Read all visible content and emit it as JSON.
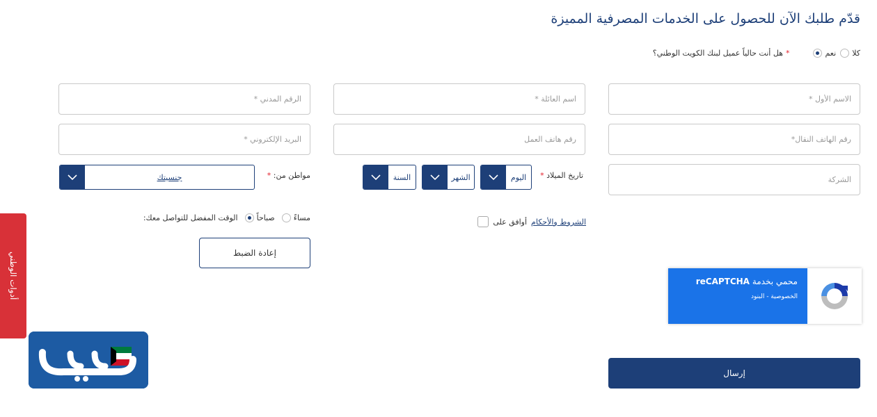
{
  "title": "قدّم طلبك الآن للحصول على الخدمات المصرفية المميزة",
  "customer_question": {
    "label": "هل أنت حالياً عميل لبنك الكويت الوطني؟",
    "required_mark": "*",
    "options": [
      {
        "label": "نعم",
        "selected": true
      },
      {
        "label": "كلا",
        "selected": false
      }
    ]
  },
  "fields": {
    "first_name": {
      "placeholder": "الاسم الأول *"
    },
    "family_name": {
      "placeholder": "اسم العائلة *"
    },
    "civil_id": {
      "placeholder": "الرقم المدني *"
    },
    "mobile": {
      "placeholder": "رقم الهاتف النقال*"
    },
    "work_phone": {
      "placeholder": "رقم هاتف العمل"
    },
    "email": {
      "placeholder": "البريد الإلكتروني *"
    },
    "company": {
      "placeholder": "الشركة"
    }
  },
  "birth_date": {
    "label": "تاريخ الميلاد",
    "required_mark": "*",
    "day": "اليوم",
    "month": "الشهر",
    "year": "السنة"
  },
  "citizenship": {
    "label": "مواطن من:",
    "required_mark": "*",
    "value": "جنسيتك"
  },
  "terms": {
    "prefix": "أوافق على",
    "link": "الشروط والأحكام"
  },
  "contact_time": {
    "label": "الوقت المفضل للتواصل معك:",
    "options": [
      {
        "label": "صباحاً",
        "selected": true
      },
      {
        "label": "مساءً",
        "selected": false
      }
    ]
  },
  "reset_label": "إعادة الضبط",
  "submit_label": "إرسال",
  "captcha": {
    "protected_by": "محمي بخدمة",
    "brand": "reCAPTCHA",
    "links": "الخصوصية - البنود"
  },
  "side_tab_label": "أدوات الوطني",
  "logo": {
    "text": "ويكي",
    "icon": "kuwait-flag-pen-icon"
  },
  "colors": {
    "primary": "#1d3f78",
    "accent_red": "#d83138",
    "captcha_blue": "#1a73e8"
  }
}
